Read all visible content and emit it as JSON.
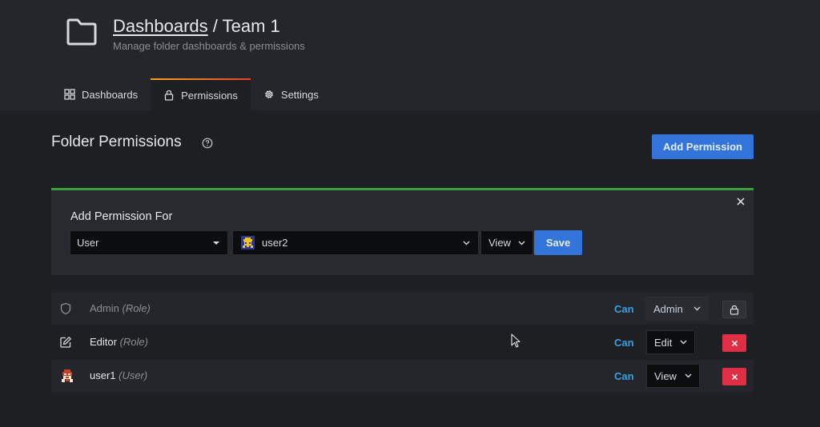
{
  "header": {
    "breadcrumb_link": "Dashboards",
    "separator": " / ",
    "title": "Team 1",
    "subtitle": "Manage folder dashboards & permissions"
  },
  "tabs": [
    {
      "label": "Dashboards",
      "icon": "grid-icon",
      "active": false
    },
    {
      "label": "Permissions",
      "icon": "lock-icon",
      "active": true
    },
    {
      "label": "Settings",
      "icon": "gear-icon",
      "active": false
    }
  ],
  "section": {
    "title": "Folder Permissions",
    "add_button": "Add Permission"
  },
  "add_panel": {
    "label": "Add Permission For",
    "type_select": "User",
    "user_select": "user2",
    "permission_select": "View",
    "save_button": "Save"
  },
  "permissions": [
    {
      "name": "Admin",
      "kind": "(Role)",
      "can": "Can",
      "level": "Admin",
      "icon": "shield-icon",
      "locked": true
    },
    {
      "name": "Editor",
      "kind": "(Role)",
      "can": "Can",
      "level": "Edit",
      "icon": "edit-icon",
      "locked": false
    },
    {
      "name": "user1",
      "kind": "(User)",
      "can": "Can",
      "level": "View",
      "icon": "user-avatar",
      "locked": false
    }
  ],
  "colors": {
    "primary": "#3274d9",
    "danger": "#e02f44",
    "link": "#33a2e5",
    "success_border": "#3a9f3a"
  }
}
